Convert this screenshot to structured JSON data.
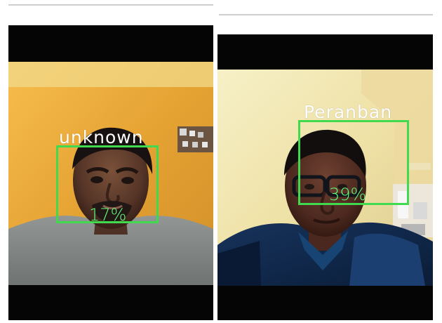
{
  "panels": [
    {
      "name": "left-camera-frame",
      "person_label": "unknown",
      "confidence_text": "17%",
      "box_color": "#41d94d",
      "confidence_color": "#62ff7c",
      "background_color": "#e6a737"
    },
    {
      "name": "right-camera-frame",
      "person_label": "Peranban",
      "confidence_text": "39%",
      "box_color": "#41d94d",
      "confidence_color": "#62ff7c",
      "background_color": "#f1e4a6"
    }
  ]
}
